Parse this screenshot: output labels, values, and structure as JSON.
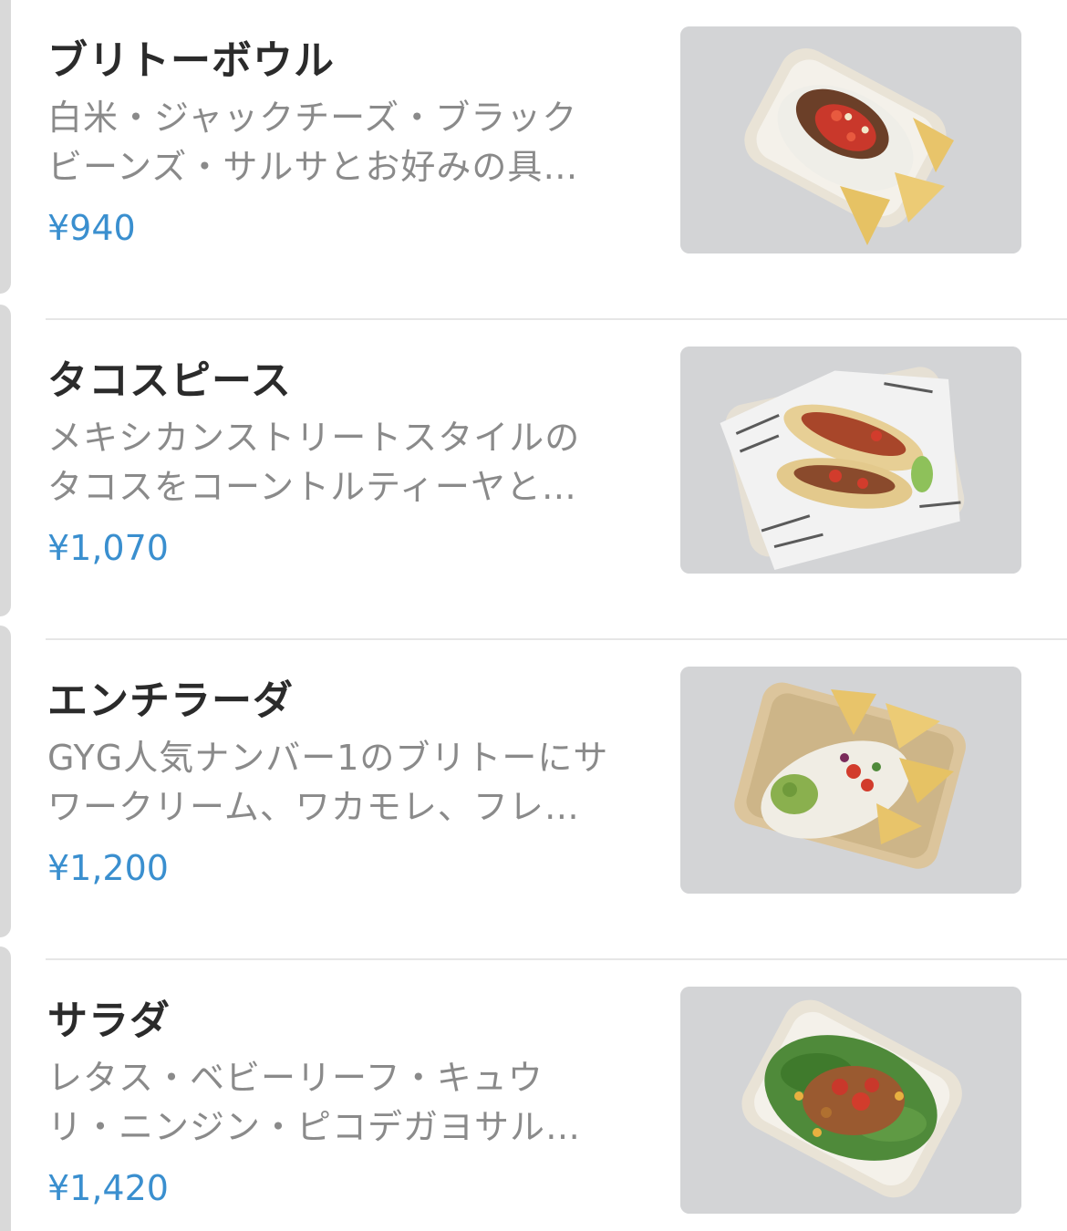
{
  "menu": {
    "items": [
      {
        "title": "ブリトーボウル",
        "description": "白米・ジャックチーズ・ブラックビーンズ・サルサとお好みの具…",
        "price": "¥940",
        "image_icon": "burrito-bowl-photo"
      },
      {
        "title": "タコスピース",
        "description": "メキシカンストリートスタイルのタコスをコーントルティーヤと…",
        "price": "¥1,070",
        "image_icon": "tacos-photo"
      },
      {
        "title": "エンチラーダ",
        "description": "GYG人気ナンバー1のブリトーにサワークリーム、ワカモレ、フレ…",
        "price": "¥1,200",
        "image_icon": "enchilada-photo"
      },
      {
        "title": "サラダ",
        "description": "レタス・ベビーリーフ・キュウリ・ニンジン・ピコデガヨサル…",
        "price": "¥1,420",
        "image_icon": "salad-photo"
      }
    ]
  },
  "colors": {
    "price": "#3a8fcf",
    "title": "#2b2b2b",
    "description": "#8a8a8a",
    "thumb_background": "#d3d4d6",
    "divider": "#e6e6e6"
  }
}
